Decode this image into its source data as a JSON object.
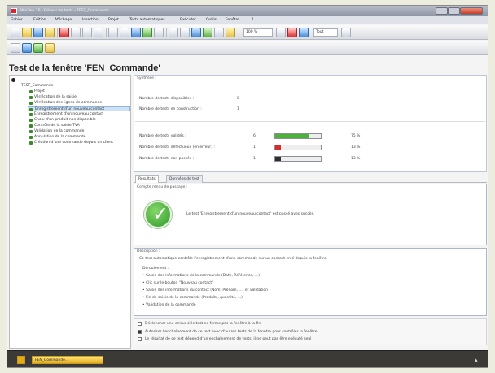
{
  "window": {
    "title": "WinDev 16 - Editeur de tests - TEST_Commande"
  },
  "menu": [
    "Fichier",
    "Edition",
    "Affichage",
    "Insertion",
    "Projet",
    "Tests automatiques",
    "Exécuter",
    "Outils",
    "Fenêtre",
    "?"
  ],
  "toolbar": {
    "zoom_value": "100 %",
    "search_value": "Tout"
  },
  "page_title": "Test de la fenêtre 'FEN_Commande'",
  "tree": {
    "root": "TEST_Commande",
    "items": [
      {
        "label": "Projet",
        "color": "#3a8a2a"
      },
      {
        "label": "Vérification de la saisie",
        "color": "#3a8a2a"
      },
      {
        "label": "Vérification des lignes de commande",
        "color": "#3a8a2a"
      },
      {
        "label": "Enregistrement d'un nouveau contact",
        "color": "#3a8a2a",
        "selected": true
      },
      {
        "label": "Enregistrement d'un nouveau contact",
        "color": "#3a8a2a"
      },
      {
        "label": "Choix d'un produit non disponible",
        "color": "#3a8a2a"
      },
      {
        "label": "Contrôle de la saisie TVA",
        "color": "#3a8a2a"
      },
      {
        "label": "Validation de la commande",
        "color": "#3a8a2a"
      },
      {
        "label": "Annulation de la commande",
        "color": "#3a8a2a"
      },
      {
        "label": "Création d'une commande depuis un client",
        "color": "#3a8a2a"
      }
    ]
  },
  "synthesis": {
    "title": "Synthèse :",
    "available_label": "Nombre de tests disponibles :",
    "available_value": "8",
    "running_label": "Nombre de tests en construction :",
    "running_value": "1",
    "stats": [
      {
        "label": "Nombre de tests validés :",
        "value": "6",
        "percent": 75,
        "percent_text": "75 %",
        "color": "#4cb23c"
      },
      {
        "label": "Nombre de tests défectueux (en erreur) :",
        "value": "1",
        "percent": 13,
        "percent_text": "13 %",
        "color": "#d62b2b"
      },
      {
        "label": "Nombre de tests non passés :",
        "value": "1",
        "percent": 13,
        "percent_text": "13 %",
        "color": "#2e2e2e"
      }
    ]
  },
  "tabs": [
    "Résultats",
    "Données de test"
  ],
  "result": {
    "title": "Compte rendu de passage :",
    "message": "Le test 'Enregistrement d'un nouveau contact' est passé avec succès."
  },
  "description": {
    "title": "Description :",
    "intro": "Ce test automatique contrôle l'enregistrement d'une commande sur un contact créé depuis la fenêtre.",
    "steps_title": "Déroulement :",
    "steps": [
      "• Saisie des informations de la commande (Date, Référence, ...)",
      "• Clic sur le bouton \"Nouveau contact\"",
      "• Saisie des informations du contact (Nom, Prénom, ...) et validation",
      "• Fin de saisie de la commande (Produits, quantité, ...)",
      "• Validation de la commande"
    ]
  },
  "options": [
    {
      "label": "Déclencher une erreur si le test ne ferme pas la fenêtre à la fin",
      "checked": false
    },
    {
      "label": "Autoriser l'enchaînement de ce test avec d'autres tests de la fenêtre pour contrôler la fenêtre",
      "checked": true
    },
    {
      "label": "Le résultat de ce test dépend d'un enchaînement de tests, il ne peut pas être exécuté seul",
      "checked": false
    }
  ],
  "statusbar": {
    "tab_label": "FEN_Commande..."
  }
}
